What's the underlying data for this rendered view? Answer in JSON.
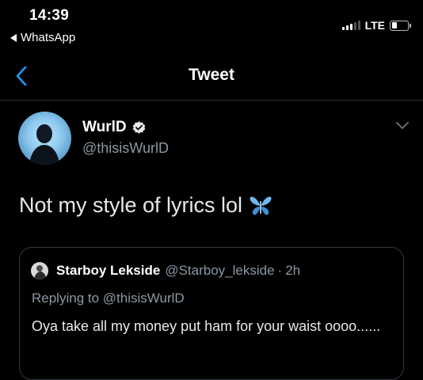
{
  "status_bar": {
    "time": "14:39",
    "back_app_label": "WhatsApp",
    "network": "LTE",
    "signal_bars_active": 3,
    "signal_bars_total": 5,
    "battery_level": 0.25
  },
  "nav": {
    "title": "Tweet",
    "back_icon": "chevron-left-icon"
  },
  "tweet": {
    "display_name": "WurlD",
    "verified": true,
    "handle": "@thisisWurlD",
    "text": "Not my style of lyrics lol",
    "emoji": "butterfly-icon",
    "more_icon": "chevron-down-icon"
  },
  "quoted_tweet": {
    "display_name": "Starboy Lekside",
    "handle": "@Starboy_lekside",
    "separator": "·",
    "time": "2h",
    "replying_to": "Replying to @thisisWurlD",
    "text": "Oya take all my money put ham for your waist oooo......"
  },
  "colors": {
    "background": "#000000",
    "accent_blue": "#1d9bf0",
    "secondary_text": "#8b98a5",
    "primary_text": "#e7e9ea",
    "divider": "#2a2d31"
  }
}
